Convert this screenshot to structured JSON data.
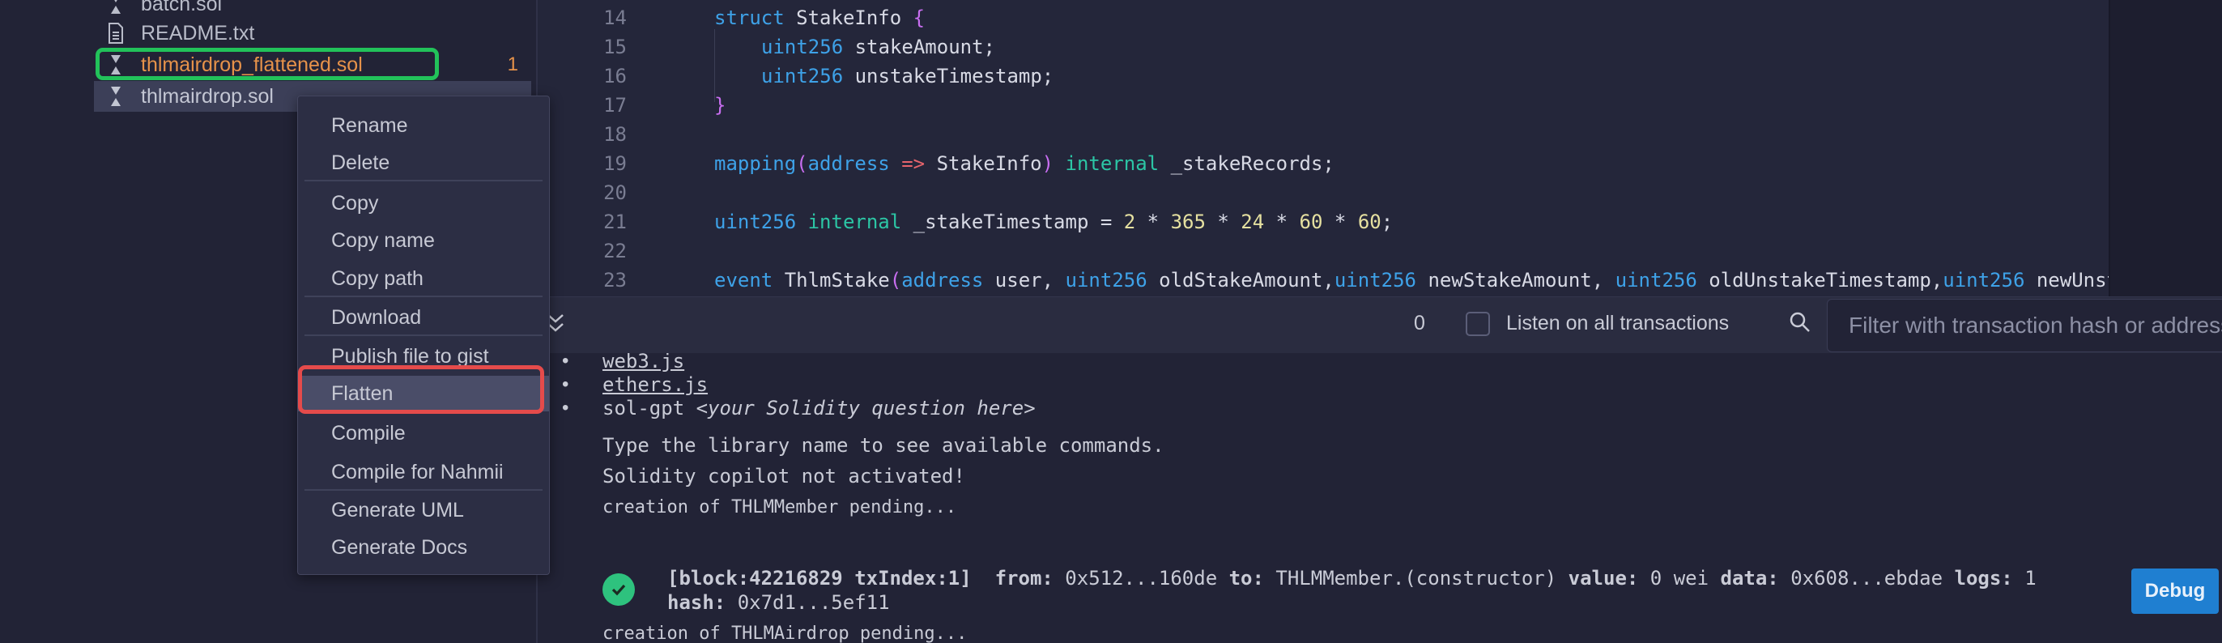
{
  "explorer": {
    "files": [
      {
        "name": "batch.sol",
        "icon": "solidity-file-icon"
      },
      {
        "name": "README.txt",
        "icon": "text-file-icon"
      },
      {
        "name": "thlmairdrop_flattened.sol",
        "icon": "solidity-file-icon",
        "badge": "1",
        "color": "#e6924a"
      },
      {
        "name": "thlmairdrop.sol",
        "icon": "solidity-file-icon"
      }
    ]
  },
  "editor": {
    "line_numbers": [
      "14",
      "15",
      "16",
      "17",
      "18",
      "19",
      "20",
      "21",
      "22",
      "23"
    ],
    "lines": {
      "l14": {
        "kw": "struct",
        "rest": " StakeInfo ",
        "brace": "{"
      },
      "l15": {
        "type": "uint256",
        "rest": " stakeAmount;"
      },
      "l16": {
        "type": "uint256",
        "rest": " unstakeTimestamp;"
      },
      "l17": {
        "brace": "}"
      },
      "l19": {
        "kw": "mapping",
        "p1": "(",
        "type": "address",
        "op": " =>",
        "rest": " StakeInfo",
        "p2": ")",
        "vis": " internal",
        "name": " _stakeRecords;"
      },
      "l21": {
        "type": "uint256",
        "vis": " internal",
        "name": " _stakeTimestamp = ",
        "n1": "2",
        "s1": " * ",
        "n2": "365",
        "s2": " * ",
        "n3": "24",
        "s3": " * ",
        "n4": "60",
        "s4": " * ",
        "n5": "60",
        "end": ";"
      },
      "l23": {
        "kw": "event",
        "rest": " ThlmStake",
        "p1": "(",
        "t1": "address",
        "a1": " user, ",
        "t2": "uint256",
        "a2": " oldStakeAmount,",
        "t3": "uint256",
        "a3": " newStakeAmount, ",
        "t4": "uint256",
        "a4": " oldUnstakeTimestamp,",
        "t5": "uint256",
        "a5": " newUnst"
      }
    }
  },
  "terminal_bar": {
    "count": "0",
    "listen_label": "Listen on all transactions",
    "filter_placeholder": "Filter with transaction hash or address"
  },
  "terminal": {
    "items": {
      "web3": "web3.js",
      "ethers": "ethers.js",
      "solgpt": "sol-gpt",
      "solgpt_hint": "<your Solidity question here>"
    },
    "help": "Type the library name to see available commands.",
    "copilot": "Solidity copilot not activated!",
    "pending1": "creation of THLMMember pending...",
    "tx": {
      "block": "[block:42216829 txIndex:1]",
      "from_label": "from:",
      "from": "0x512...160de",
      "to_label": "to:",
      "to": "THLMMember.(constructor)",
      "value_label": "value:",
      "value": "0 wei",
      "data_label": "data:",
      "data": "0x608...ebdae",
      "logs_label": "logs:",
      "logs": "1",
      "hash_label": "hash:",
      "hash": "0x7d1...5ef11"
    },
    "debug": "Debug",
    "pending2": "creation of THLMAirdrop pending..."
  },
  "context_menu": {
    "items": [
      "Rename",
      "Delete",
      "Copy",
      "Copy name",
      "Copy path",
      "Download",
      "Publish file to gist",
      "Flatten",
      "Compile",
      "Compile for Nahmii",
      "Generate UML",
      "Generate Docs"
    ]
  },
  "colors": {
    "highlight_green": "#22c25a",
    "highlight_red": "#e54b4b",
    "accent_blue": "#1f7fd1"
  }
}
